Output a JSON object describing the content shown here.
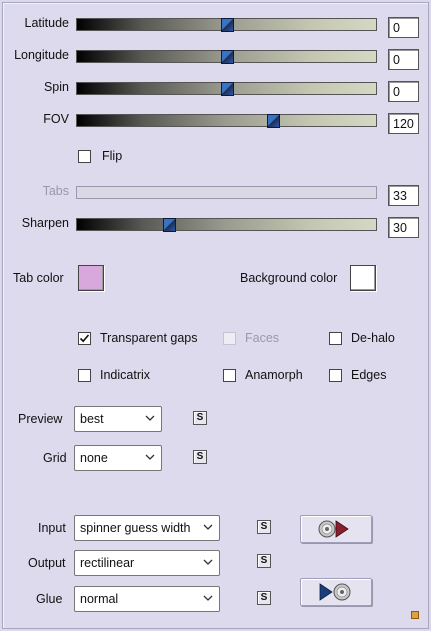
{
  "sliders": [
    {
      "label": "Latitude",
      "value": "0",
      "fraction": 0.5,
      "disabled": false
    },
    {
      "label": "Longitude",
      "value": "0",
      "fraction": 0.5,
      "disabled": false
    },
    {
      "label": "Spin",
      "value": "0",
      "fraction": 0.5,
      "disabled": false
    },
    {
      "label": "FOV",
      "value": "120",
      "fraction": 0.66,
      "disabled": false
    },
    {
      "label": "Tabs",
      "value": "33",
      "fraction": null,
      "disabled": true
    },
    {
      "label": "Sharpen",
      "value": "30",
      "fraction": 0.3,
      "disabled": false
    }
  ],
  "flip": {
    "label": "Flip",
    "checked": false
  },
  "colors": {
    "tab_label": "Tab color",
    "tab_value": "#d8a8dc",
    "background_label": "Background color",
    "background_value": "#ffffff"
  },
  "options": {
    "transparent_gaps": {
      "label": "Transparent gaps",
      "checked": true
    },
    "faces": {
      "label": "Faces",
      "checked": false,
      "disabled": true
    },
    "de_halo": {
      "label": "De-halo",
      "checked": false
    },
    "indicatrix": {
      "label": "Indicatrix",
      "checked": false
    },
    "anamorph": {
      "label": "Anamorph",
      "checked": false
    },
    "edges": {
      "label": "Edges",
      "checked": false
    }
  },
  "preview": {
    "label": "Preview",
    "value": "best"
  },
  "grid": {
    "label": "Grid",
    "value": "none"
  },
  "input": {
    "label": "Input",
    "value": "spinner guess width"
  },
  "output": {
    "label": "Output",
    "value": "rectilinear"
  },
  "glue": {
    "label": "Glue",
    "value": "normal"
  },
  "s_button_label": "S",
  "accent_color": "#2d5aa7"
}
